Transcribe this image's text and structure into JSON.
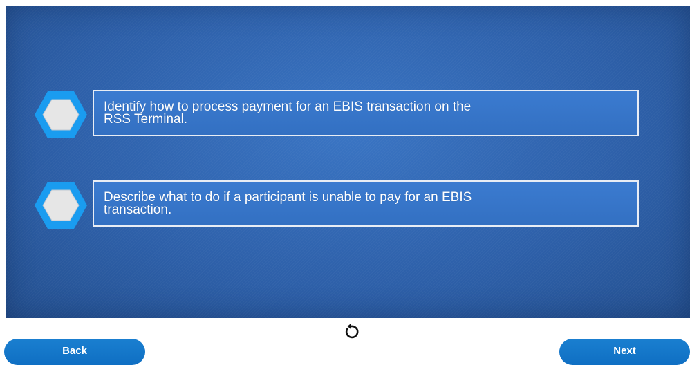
{
  "objectives": [
    {
      "line1": "Identify how to process payment for an EBIS transaction on the",
      "line2": "RSS Terminal."
    },
    {
      "line1": "Describe what to do if a participant is unable to pay for an EBIS",
      "line2": "transaction."
    }
  ],
  "nav": {
    "back_label": "Back",
    "next_label": "Next"
  },
  "icons": {
    "objective_marker": "hexagon-icon",
    "replay": "replay-icon"
  },
  "colors": {
    "stage_blue": "#2f63ad",
    "hexagon_outline": "#1a9cf0",
    "hexagon_fill": "#e6e6e6",
    "button_blue": "#1577c8"
  }
}
